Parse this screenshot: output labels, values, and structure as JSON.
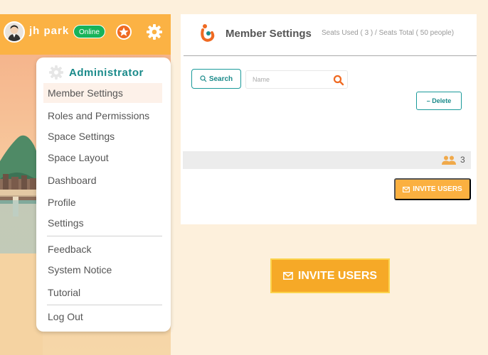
{
  "header": {
    "username": "jh park",
    "status": "Online",
    "icons": [
      "avatar",
      "star-icon",
      "gear-icon"
    ]
  },
  "admin_menu": {
    "title": "Administrator",
    "items": [
      {
        "label": "Member Settings",
        "active": true
      },
      {
        "label": "Roles and Permissions"
      },
      {
        "label": "Space Settings"
      },
      {
        "label": "Space Layout"
      },
      {
        "label": "Dashboard"
      },
      {
        "label": "Profile"
      },
      {
        "label": "Settings"
      }
    ],
    "secondary_items": [
      {
        "label": "Feedback"
      },
      {
        "label": "System Notice"
      },
      {
        "label": "Tutorial"
      }
    ],
    "logout": "Log Out"
  },
  "member_settings": {
    "title": "Member Settings",
    "seats": "Seats Used ( 3 ) / Seats Total ( 50 people)",
    "search_label": "Search",
    "name_placeholder": "Name",
    "delete_label": "– Delete",
    "member_count": "3",
    "invite_label": "INVITE USERS"
  },
  "invite_big_label": "INVITE USERS",
  "colors": {
    "accent": "#fbb244",
    "teal": "#1a8a8a",
    "online": "#17b35a",
    "orange": "#ef6a22"
  }
}
